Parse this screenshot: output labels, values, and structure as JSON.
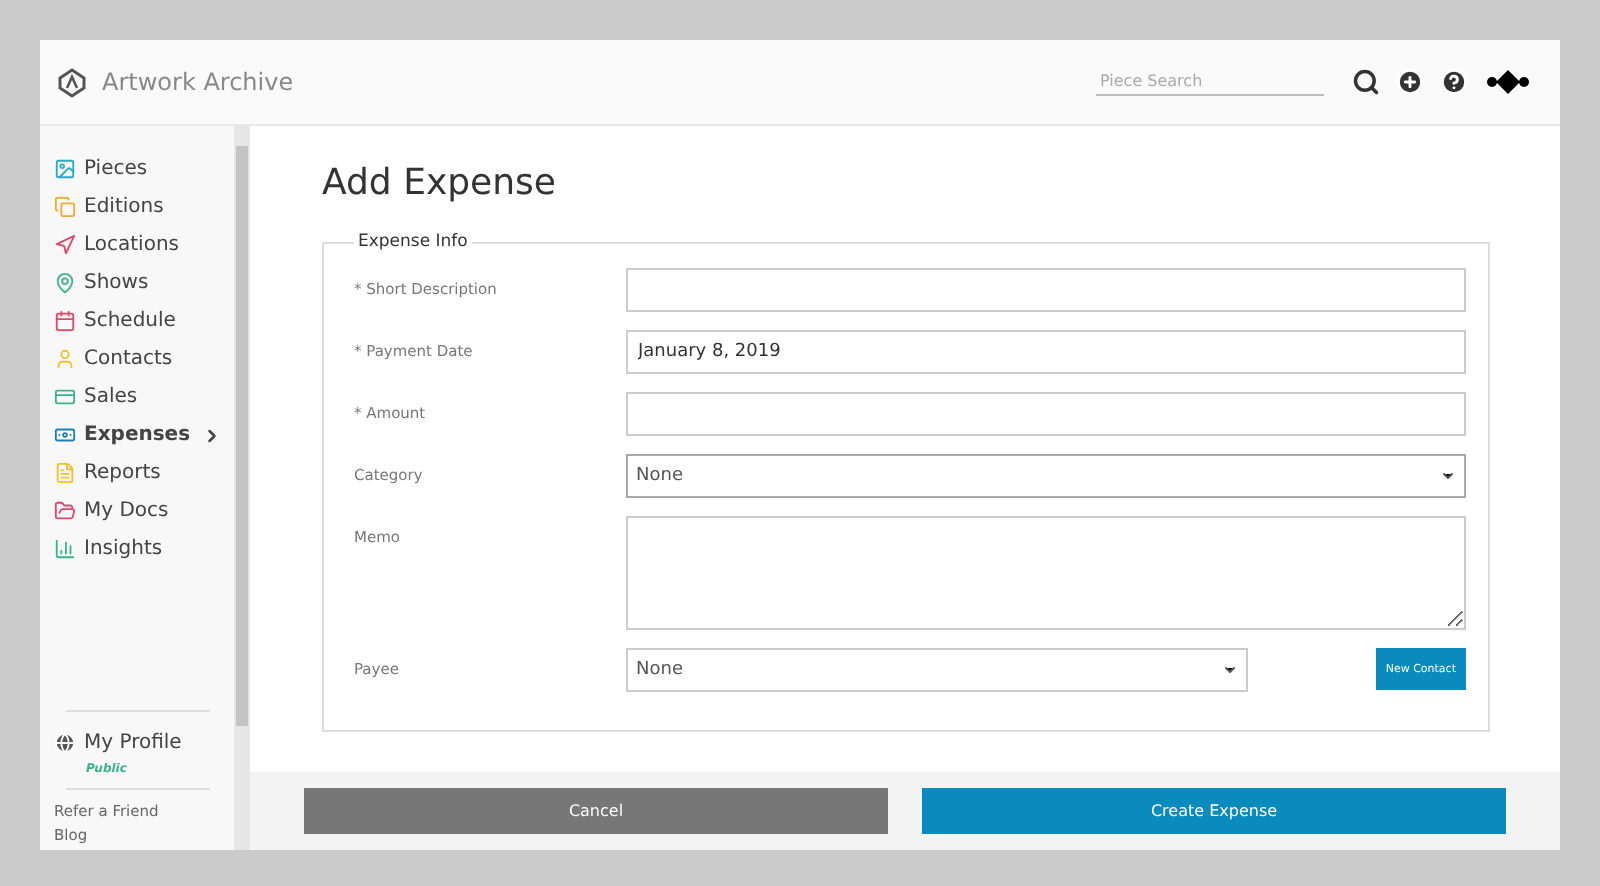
{
  "header": {
    "brand": "Artwork Archive",
    "search": {
      "placeholder": "Piece Search"
    }
  },
  "sidebar": {
    "items": [
      {
        "label": "Pieces",
        "kind": "image",
        "color": "#2aa7c9",
        "selected": false
      },
      {
        "label": "Editions",
        "kind": "copy",
        "color": "#f0a830",
        "selected": false
      },
      {
        "label": "Locations",
        "kind": "nav",
        "color": "#e0476a",
        "selected": false
      },
      {
        "label": "Shows",
        "kind": "pin",
        "color": "#3cb489",
        "selected": false
      },
      {
        "label": "Schedule",
        "kind": "calendar",
        "color": "#e0476a",
        "selected": false
      },
      {
        "label": "Contacts",
        "kind": "user",
        "color": "#f0c030",
        "selected": false
      },
      {
        "label": "Sales",
        "kind": "card",
        "color": "#3cb489",
        "selected": false
      },
      {
        "label": "Expenses",
        "kind": "money",
        "color": "#1f7fb5",
        "selected": true
      },
      {
        "label": "Reports",
        "kind": "file",
        "color": "#f0c030",
        "selected": false
      },
      {
        "label": "My Docs",
        "kind": "folder",
        "color": "#e0476a",
        "selected": false
      },
      {
        "label": "Insights",
        "kind": "chart",
        "color": "#3cb489",
        "selected": false
      }
    ],
    "profile": {
      "label": "My Profile",
      "status": "Public"
    },
    "links": [
      "Refer a Friend",
      "Blog"
    ]
  },
  "page": {
    "title": "Add Expense",
    "section": "Expense Info",
    "fields": [
      {
        "kind": "text",
        "label": "* Short Description"
      },
      {
        "kind": "text",
        "label": "* Payment Date",
        "value": "January 8, 2019"
      },
      {
        "kind": "text",
        "label": "* Amount"
      },
      {
        "kind": "select",
        "label": "Category",
        "value": "None"
      },
      {
        "kind": "textarea",
        "label": "Memo"
      },
      {
        "kind": "select",
        "label": "Payee",
        "value": "None",
        "button": "New Contact"
      }
    ]
  },
  "footer": {
    "buttons": [
      {
        "label": "Cancel",
        "kind": "secondary"
      },
      {
        "label": "Create Expense",
        "kind": "primary"
      }
    ]
  }
}
